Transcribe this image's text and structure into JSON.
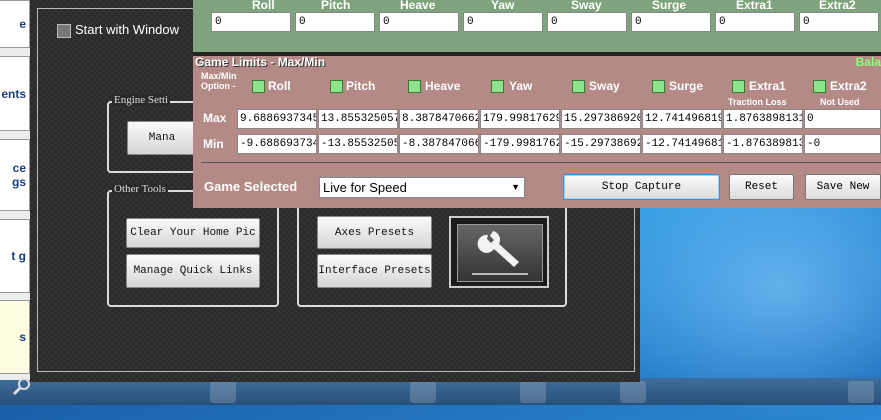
{
  "sidebar": {
    "items": [
      {
        "label": "e"
      },
      {
        "label": "ents"
      },
      {
        "label": "ce gs"
      },
      {
        "label": "t g"
      },
      {
        "label": "s"
      }
    ]
  },
  "main": {
    "start_with_windows": "Start with Window",
    "engine_group": {
      "title": "Engine Setti",
      "manage_label": "Mana"
    },
    "other_tools": {
      "title": "Other Tools",
      "clear_home_pic": "Clear Your Home Pic",
      "manage_quick_links": "Manage Quick Links"
    },
    "presets": {
      "axes_presets": "Axes Presets",
      "interface_presets": "Interface Presets"
    }
  },
  "green_panel": {
    "headers": [
      "Roll",
      "Pitch",
      "Heave",
      "Yaw",
      "Sway",
      "Surge",
      "Extra1",
      "Extra2"
    ],
    "values": [
      "0",
      "0",
      "0",
      "0",
      "0",
      "0",
      "0",
      "0"
    ]
  },
  "game_limits": {
    "title": "Game Limits - Max/Min",
    "bala_label": "Bala",
    "option_label_line1": "Max/Min",
    "option_label_line2": "Option -",
    "options": [
      {
        "label": "Roll"
      },
      {
        "label": "Pitch"
      },
      {
        "label": "Heave"
      },
      {
        "label": "Yaw"
      },
      {
        "label": "Sway"
      },
      {
        "label": "Surge"
      },
      {
        "label": "Extra1",
        "sub": "Traction Loss"
      },
      {
        "label": "Extra2",
        "sub": "Not Used"
      }
    ],
    "max_label": "Max",
    "min_label": "Min",
    "max_values": [
      "9.6886937345",
      "13.855325057",
      "8.3878470662",
      "179.99817629",
      "15.297386920",
      "12.741496819",
      "1.8763898131",
      "0"
    ],
    "min_values": [
      "-9.688693734",
      "-13.85532505",
      "-8.387847066",
      "-179.9981762",
      "-15.29738692",
      "-12.74149681",
      "-1.876389813",
      "-0"
    ],
    "game_selected_label": "Game Selected",
    "game_selected_value": "Live for Speed",
    "stop_capture": "Stop Capture",
    "reset": "Reset",
    "save_new": "Save New"
  },
  "icons": {
    "start_checkbox": "checkbox-icon",
    "wrench": "wrench-icon",
    "magnifier": "magnifier-icon",
    "dropdown": "chevron-down-icon"
  },
  "colors": {
    "green_panel": "#7fa37c",
    "limits_panel": "#b48a86",
    "checkbox_green": "#8ee48b",
    "bala": "#8fff7a"
  }
}
